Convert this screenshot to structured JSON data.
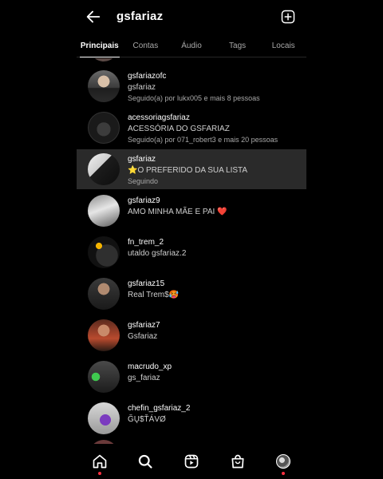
{
  "header": {
    "title": "gsfariaz",
    "back_icon": "arrow-left-icon",
    "plus_icon": "plus-square-icon"
  },
  "tabs": [
    {
      "label": "Principais",
      "active": true
    },
    {
      "label": "Contas",
      "active": false
    },
    {
      "label": "Áudio",
      "active": false
    },
    {
      "label": "Tags",
      "active": false
    },
    {
      "label": "Locais",
      "active": false
    }
  ],
  "results": [
    {
      "username": "gsfariazofc",
      "subtitle": "gsfariaz",
      "meta": "Seguido(a) por lukx005 e mais 8 pessoas",
      "highlight": false
    },
    {
      "username": "acessoriagsfariaz",
      "subtitle": "ACESSÓRIA DO GSFARIAZ",
      "meta": "Seguido(a) por 071_robert3 e mais 20 pessoas",
      "highlight": false
    },
    {
      "username": "gsfariaz",
      "subtitle": "⭐O PREFERIDO DA SUA LISTA",
      "meta": "Seguindo",
      "highlight": true
    },
    {
      "username": "gsfariaz9",
      "subtitle": "AMO MINHA MÃE E PAI ❤️",
      "meta": "",
      "highlight": false
    },
    {
      "username": "fn_trem_2",
      "subtitle": "utaldo gsfariaz.2",
      "meta": "",
      "highlight": false
    },
    {
      "username": "gsfariaz15",
      "subtitle": "Real Trem$🥵",
      "meta": "",
      "highlight": false
    },
    {
      "username": "gsfariaz7",
      "subtitle": "Gsfariaz",
      "meta": "",
      "highlight": false
    },
    {
      "username": "macrudo_xp",
      "subtitle": "gs_fariaz",
      "meta": "",
      "highlight": false
    },
    {
      "username": "chefin_gsfariaz_2",
      "subtitle": "ĞŲ$ŤÁVØ",
      "meta": "",
      "highlight": false
    }
  ],
  "bottom_nav": [
    {
      "icon": "home-icon",
      "active": true
    },
    {
      "icon": "search-icon",
      "active": false
    },
    {
      "icon": "reels-icon",
      "active": false
    },
    {
      "icon": "shop-icon",
      "active": false
    },
    {
      "icon": "profile-avatar",
      "active": false
    }
  ],
  "colors": {
    "background": "#000000",
    "highlight_row": "#2a2a2a",
    "secondary_text": "#a8a8a8",
    "notification_dot": "#ff3040"
  }
}
